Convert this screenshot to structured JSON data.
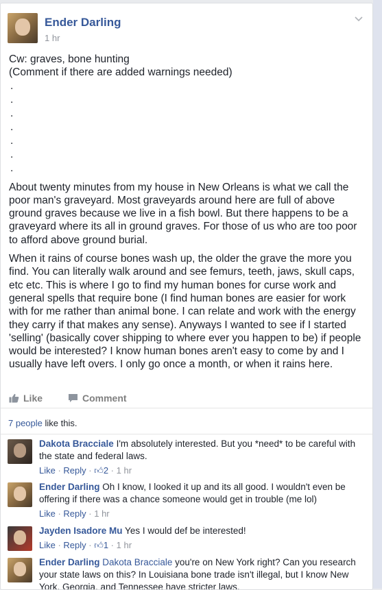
{
  "post": {
    "author": "Ender Darling",
    "time": "1 hr",
    "lines_intro": [
      "Cw: graves, bone hunting",
      "(Comment if there are added warnings needed)"
    ],
    "dots": [
      ".",
      ".",
      ".",
      ".",
      ".",
      ".",
      "."
    ],
    "para1": [
      "About twenty minutes from my house in New Orleans is what we call the",
      "poor man's graveyard. Most graveyards around here are full of above",
      "ground graves because we live in a fish bowl. But there happens to be a",
      "graveyard where its all in ground graves. For those of us who are too poor",
      "to afford above ground burial."
    ],
    "para2": [
      "When it rains of course bones wash up, the older the grave the more you",
      "find. You can literally walk around and see femurs, teeth, jaws, skull caps,",
      "etc etc. This is where I go to find my human bones for curse work and",
      "general spells that require bone (I find human bones are easier for work",
      "with for me rather than animal bone. I can relate and work with the energy",
      "they carry if that makes any sense). Anyways I wanted to see if I started",
      "'selling' (basically cover shipping to where ever you happen to be) if people",
      "would be interested? I know human bones aren't easy to come by and I",
      "usually have left overs. I only go once a month, or when it rains here."
    ]
  },
  "actions": {
    "like": "Like",
    "comment": "Comment"
  },
  "likes": {
    "count": "7 people",
    "suffix": " like this."
  },
  "comments": [
    {
      "name": "Dakota Bracciale",
      "lines": [
        " I'm absolutely interested. But you *need* to be careful with",
        "the state and federal laws."
      ],
      "like": "Like",
      "reply": "Reply",
      "reactions": "2",
      "time": "1 hr"
    },
    {
      "name": "Ender Darling",
      "lines": [
        " Oh I know, I looked it up and its all good. I wouldn't even be",
        "offering if there was a chance someone would get in trouble (me lol)"
      ],
      "like": "Like",
      "reply": "Reply",
      "time": "1 hr"
    },
    {
      "name": "Jayden Isadore Mu",
      "lines": [
        " Yes I would def be interested!"
      ],
      "like": "Like",
      "reply": "Reply",
      "reactions": "1",
      "time": "1 hr"
    },
    {
      "name": "Ender Darling",
      "tag": "Dakota Bracciale",
      "lines": [
        " you're on New York right? Can you research",
        "your state laws on this? In Louisiana bone trade isn't illegal, but I know New",
        "York, Georgia, and Tennessee have stricter laws."
      ]
    }
  ],
  "separators": {
    "meta_dot": " · ",
    "reply_dot": " · "
  }
}
